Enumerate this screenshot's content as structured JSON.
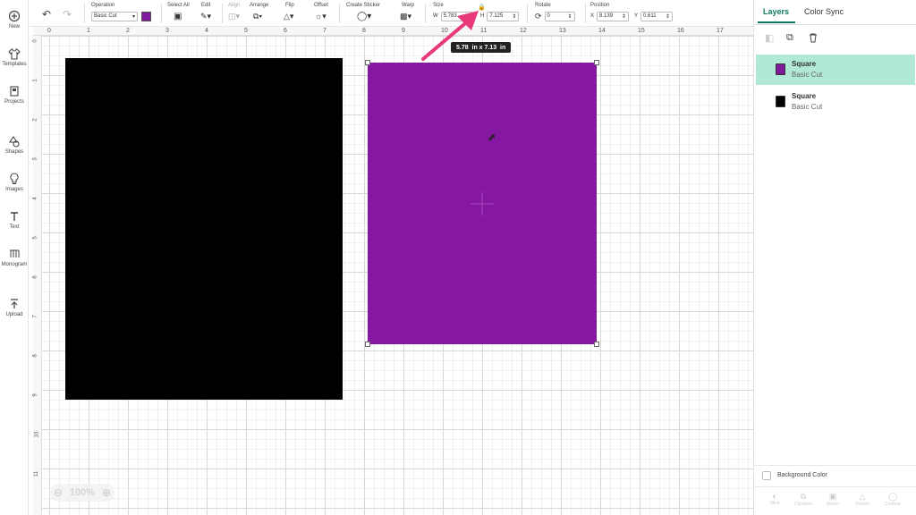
{
  "sidebar": {
    "items": [
      {
        "label": "New",
        "icon": "plus-circle-icon"
      },
      {
        "label": "Templates",
        "icon": "shirt-icon"
      },
      {
        "label": "Projects",
        "icon": "projects-icon"
      },
      {
        "label": "Shapes",
        "icon": "shapes-icon"
      },
      {
        "label": "Images",
        "icon": "lightbulb-icon"
      },
      {
        "label": "Text",
        "icon": "text-icon"
      },
      {
        "label": "Monogram",
        "icon": "monogram-icon"
      },
      {
        "label": "Upload",
        "icon": "upload-icon"
      }
    ]
  },
  "toolbar": {
    "operation_label": "Operation",
    "operation_value": "Basic Cut",
    "operation_color": "#7e1a9b",
    "select_all_label": "Select All",
    "edit_label": "Edit",
    "align_label": "Align",
    "arrange_label": "Arrange",
    "flip_label": "Flip",
    "offset_label": "Offset",
    "create_sticker_label": "Create Sticker",
    "warp_label": "Warp",
    "size_label": "Size",
    "size_w_prefix": "W",
    "size_w_value": "5.783",
    "size_h_prefix": "H",
    "size_h_value": "7.125",
    "rotate_label": "Rotate",
    "rotate_value": "0",
    "position_label": "Position",
    "pos_x_prefix": "X",
    "pos_x_value": "8.139",
    "pos_y_prefix": "Y",
    "pos_y_value": "0.611"
  },
  "ruler": {
    "top": [
      "0",
      "1",
      "2",
      "3",
      "4",
      "5",
      "6",
      "7",
      "8",
      "9",
      "10",
      "11",
      "12",
      "13",
      "14",
      "15",
      "16",
      "17"
    ],
    "left": [
      "0",
      "1",
      "2",
      "3",
      "4",
      "5",
      "6",
      "7",
      "8",
      "9",
      "10",
      "11"
    ]
  },
  "canvas": {
    "size_tooltip": "5.78  in x 7.13  in",
    "zoom": "100%",
    "black_shape_color": "#000000",
    "purple_shape_color": "#8617a1",
    "arrow_color": "#e8397a"
  },
  "panel": {
    "tab_layers": "Layers",
    "tab_color_sync": "Color Sync",
    "layers": [
      {
        "name": "Square",
        "sub": "Basic Cut",
        "color": "#7e1a9b",
        "selected": true
      },
      {
        "name": "Square",
        "sub": "Basic Cut",
        "color": "#000000",
        "selected": false
      }
    ],
    "background_color_label": "Background Color",
    "bottom_actions": [
      "Slice",
      "Combine",
      "Attach",
      "Flatten",
      "Contour"
    ],
    "accent": "#0f7a5f",
    "selected_row_bg": "#b2e8d6"
  }
}
